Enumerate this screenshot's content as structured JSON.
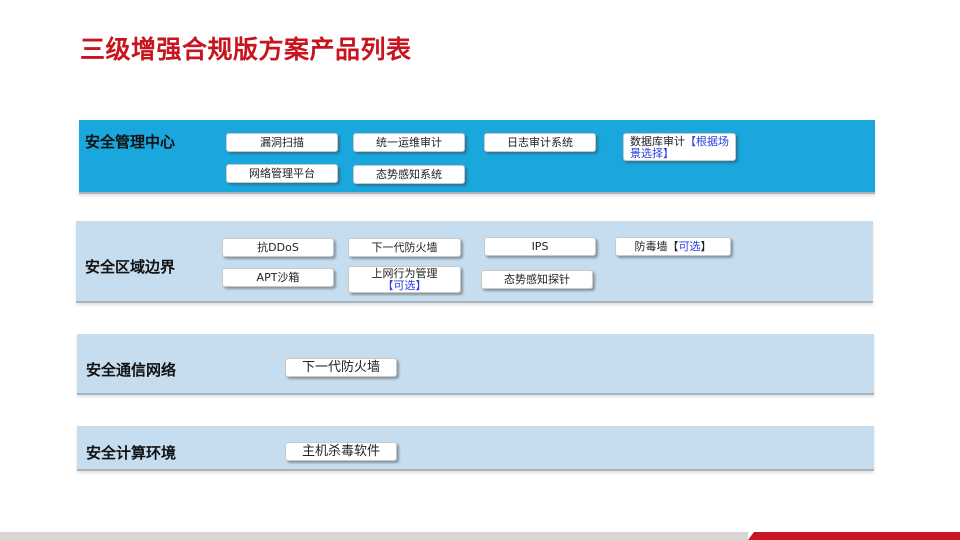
{
  "title": "三级增强合规版方案产品列表",
  "sections": [
    {
      "label": "安全管理中心",
      "items": [
        {
          "text": "漏洞扫描"
        },
        {
          "text": "统一运维审计"
        },
        {
          "text": "日志审计系统"
        },
        {
          "text": "数据库审计",
          "note": "【根据场景选择】"
        },
        {
          "text": "网络管理平台"
        },
        {
          "text": "态势感知系统"
        }
      ]
    },
    {
      "label": "安全区域边界",
      "items": [
        {
          "text": "抗DDoS"
        },
        {
          "text": "下一代防火墙"
        },
        {
          "text": "IPS"
        },
        {
          "text": "防毒墙",
          "note_open": "【",
          "note_mid": "可选",
          "note_close": "】"
        },
        {
          "text": "APT沙箱"
        },
        {
          "text": "上网行为管理",
          "note": "【可选】"
        },
        {
          "text": "态势感知探针"
        }
      ]
    },
    {
      "label": "安全通信网络",
      "items": [
        {
          "text": "下一代防火墙"
        }
      ]
    },
    {
      "label": "安全计算环境",
      "items": [
        {
          "text": "主机杀毒软件"
        }
      ]
    }
  ],
  "colors": {
    "title": "#c8141e",
    "band_dark": "#1aa7dd",
    "band_light": "#c5ddef",
    "optional_text": "#2b3fe0",
    "footer_gray": "#d6d6d6",
    "footer_red": "#c8141e"
  }
}
